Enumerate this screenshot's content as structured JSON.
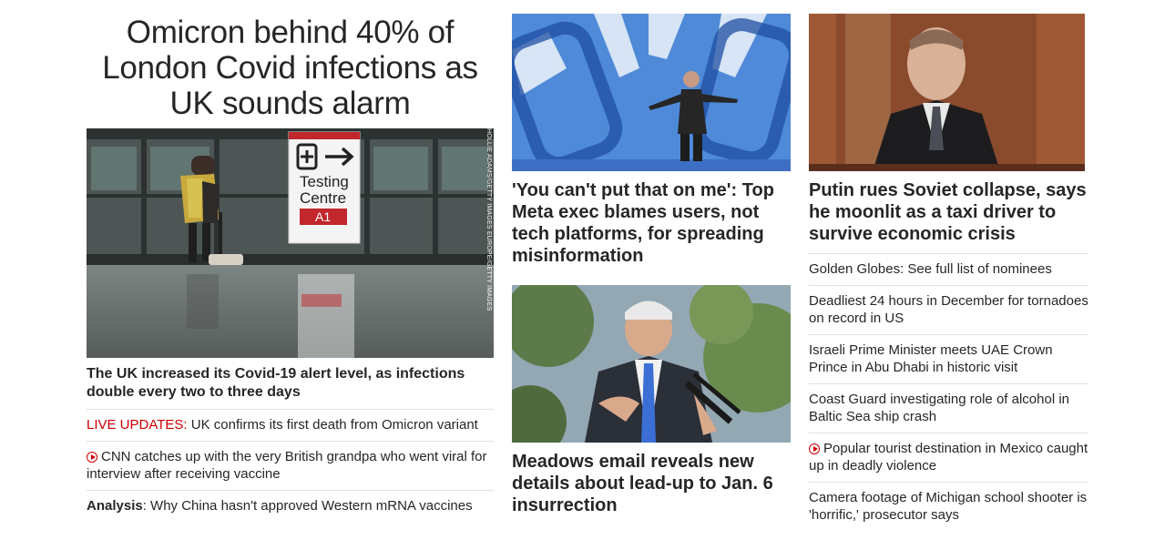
{
  "colors": {
    "text": "#262626",
    "live_red": "#cc0000",
    "divider": "#e1e1e1"
  },
  "lead": {
    "headline": "Omicron behind 40% of London Covid infections as UK sounds alarm",
    "photo_credit": "HOLLIE ADAMS/GETTY IMAGES EUROPE/GETTY IMAGES",
    "sign": {
      "line1": "Testing",
      "line2": "Centre",
      "badge": "A1"
    },
    "caption": "The UK increased its Covid-19 alert level, as infections double every two to three days",
    "related": [
      {
        "prefix": "LIVE UPDATES:",
        "text": " UK confirms its first death from Omicron variant"
      },
      {
        "icon": "play-icon",
        "text": "CNN catches up with the very British grandpa who went viral for interview after receiving vaccine"
      },
      {
        "prefix": "Analysis",
        "text": ": Why China hasn't approved Western mRNA vaccines"
      }
    ]
  },
  "middle": {
    "story1": {
      "title": "'You can't put that on me': Top Meta exec blames users, not tech platforms, for spreading misinformation"
    },
    "story2": {
      "title": "Meadows email reveals new details about lead-up to Jan. 6 insurrection"
    }
  },
  "right": {
    "story": {
      "title": "Putin rues Soviet collapse, says he moonlit as a taxi driver to survive economic crisis"
    },
    "links": [
      {
        "text": "Golden Globes: See full list of nominees"
      },
      {
        "text": "Deadliest 24 hours in December for tornadoes on record in US"
      },
      {
        "text": "Israeli Prime Minister meets UAE Crown Prince in Abu Dhabi in historic visit"
      },
      {
        "text": "Coast Guard investigating role of alcohol in Baltic Sea ship crash"
      },
      {
        "icon": "play-icon",
        "text": "Popular tourist destination in Mexico caught up in deadly violence"
      },
      {
        "text": "Camera footage of Michigan school shooter is 'horrific,' prosecutor says"
      }
    ]
  }
}
